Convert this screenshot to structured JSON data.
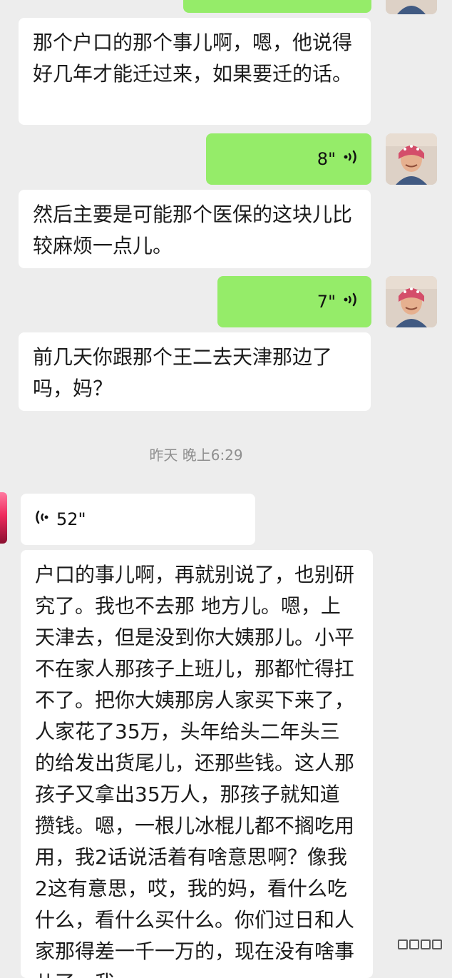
{
  "messages": {
    "m1": "那个户口的那个事儿啊，嗯，他说得好几年才能迁过来，如果要迁的话。",
    "v1": "8\"",
    "m2": "然后主要是可能那个医保的这块儿比较麻烦一点儿。",
    "v2": "7\"",
    "m3": "前几天你跟那个王二去天津那边了吗，妈？",
    "timestamp": "昨天 晚上6:29",
    "v3": "52\"",
    "m4": "户口的事儿啊，再就别说了，也别研究了。我也不去那 地方儿。嗯，上天津去，但是没到你大姨那儿。小平不在家人那孩子上班儿，那都忙得扛不了。把你大姨那房人家买下来了，人家花了35万，头年给头二年头三的给发出货尾儿，还那些钱。这人那孩子又拿出35万人，那孩子就知道攒钱。嗯，一根儿冰棍儿都不搁吃用用，我2话说活着有啥意思啊？像我2这有意思，哎，我的妈，看什么吃什么，看什么买什么。你们过日和人家那得差一千一万的，现在没有啥事儿了，我一"
  },
  "colors": {
    "background": "#ededed",
    "incoming_bubble": "#ffffff",
    "outgoing_bubble": "#95ec69"
  },
  "icons": {
    "voice": "voice-wave-icon",
    "avatar": "avatar-icon"
  }
}
